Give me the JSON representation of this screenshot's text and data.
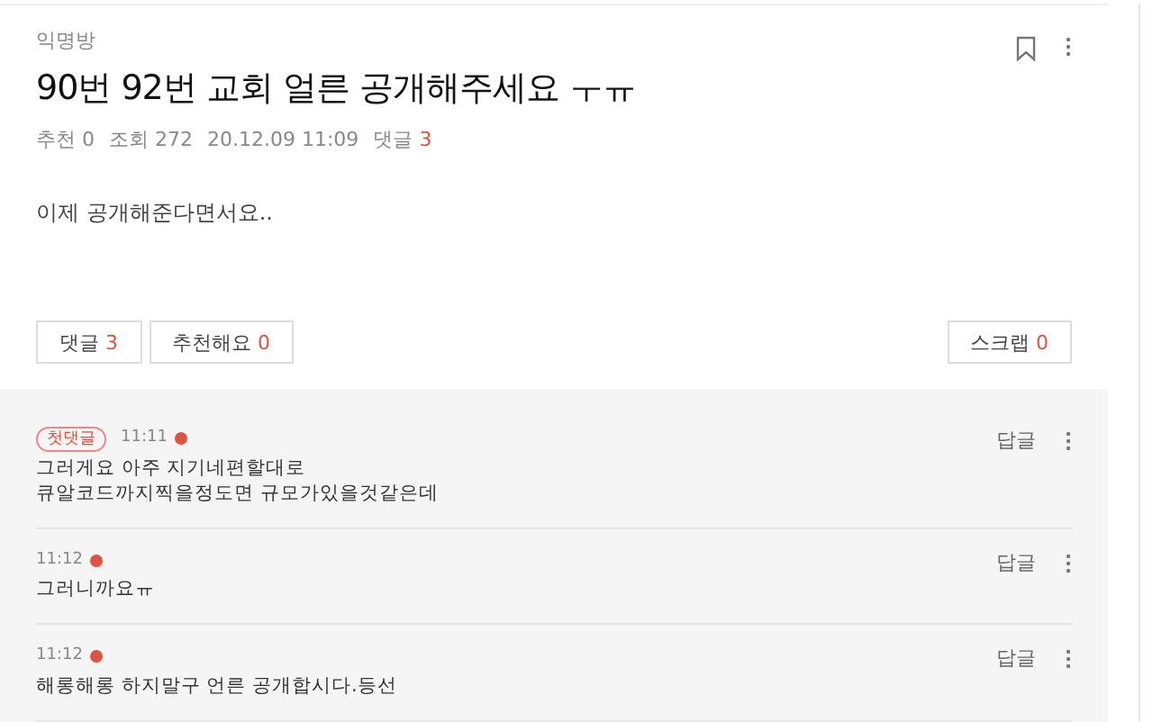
{
  "post": {
    "board": "익명방",
    "title": "90번 92번 교회 얼른 공개해주세요 ㅜㅠ",
    "meta": [
      {
        "label": "추천",
        "value": "0"
      },
      {
        "label": "조회",
        "value": "272"
      }
    ],
    "date": "20.12.09 11:09",
    "comments_label": "댓글",
    "comments_count": "3",
    "body": "이제 공개해준다면서요..",
    "actions": [
      {
        "label": "댓글",
        "count": "3"
      },
      {
        "label": "추천해요",
        "count": "0"
      }
    ],
    "scrap": {
      "label": "스크랩",
      "count": "0"
    }
  },
  "comments": [
    {
      "badge": "첫댓글",
      "time": "11:11",
      "new": true,
      "text": "그러게요 아주 지기네편할대로\n큐알코드까지찍을정도면 규모가있을것같은데",
      "reply": "답글"
    },
    {
      "time": "11:12",
      "new": true,
      "text": "그러니까요ㅠ",
      "reply": "답글"
    },
    {
      "time": "11:12",
      "new": true,
      "text": "해롱해롱 하지말구 언른 공개합시다.등선",
      "reply": "답글"
    }
  ]
}
